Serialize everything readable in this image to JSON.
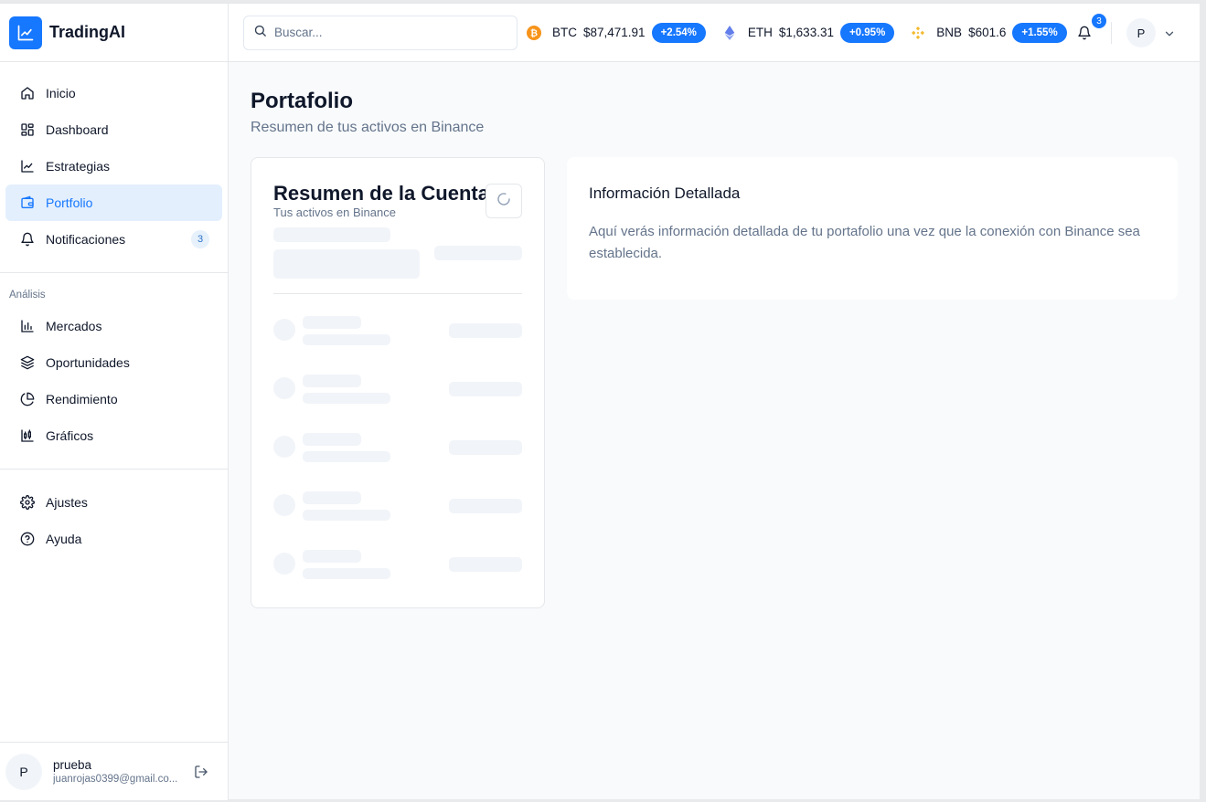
{
  "app": {
    "name": "TradingAI"
  },
  "sidebar": {
    "main_items": [
      {
        "label": "Inicio",
        "icon": "home-icon"
      },
      {
        "label": "Dashboard",
        "icon": "grid-icon"
      },
      {
        "label": "Estrategias",
        "icon": "line-chart-icon"
      },
      {
        "label": "Portfolio",
        "icon": "wallet-icon",
        "active": true
      },
      {
        "label": "Notificaciones",
        "icon": "bell-icon",
        "badge": "3"
      }
    ],
    "section_label": "Análisis",
    "analysis_items": [
      {
        "label": "Mercados",
        "icon": "bar-chart-icon"
      },
      {
        "label": "Oportunidades",
        "icon": "layers-icon"
      },
      {
        "label": "Rendimiento",
        "icon": "pie-chart-icon"
      },
      {
        "label": "Gráficos",
        "icon": "candlestick-chart-icon"
      }
    ],
    "bottom_items": [
      {
        "label": "Ajustes",
        "icon": "gear-icon"
      },
      {
        "label": "Ayuda",
        "icon": "help-circle-icon"
      }
    ],
    "user": {
      "initial": "P",
      "name": "prueba",
      "email": "juanrojas0399@gmail.co..."
    }
  },
  "header": {
    "search_placeholder": "Buscar...",
    "tickers": [
      {
        "symbol": "BTC",
        "price": "$87,471.91",
        "change": "+2.54%",
        "color": "#f7931a",
        "icon": "bitcoin-icon"
      },
      {
        "symbol": "ETH",
        "price": "$1,633.31",
        "change": "+0.95%",
        "color": "#627eea",
        "icon": "ethereum-icon"
      },
      {
        "symbol": "BNB",
        "price": "$601.6",
        "change": "+1.55%",
        "color": "#f3ba2f",
        "icon": "bnb-icon"
      }
    ],
    "notification_count": "3",
    "avatar_initial": "P"
  },
  "page": {
    "title": "Portafolio",
    "subtitle": "Resumen de tus activos en Binance"
  },
  "account_card": {
    "title": "Resumen de la Cuenta",
    "subtitle": "Tus activos en Binance"
  },
  "detail_card": {
    "title": "Información Detallada",
    "body": "Aquí verás información detallada de tu portafolio una vez que la conexión con Binance sea establecida."
  },
  "colors": {
    "accent": "#1677ff",
    "active_bg": "#e3effd",
    "muted_text": "#64748b",
    "skeleton": "#f1f4f8"
  }
}
